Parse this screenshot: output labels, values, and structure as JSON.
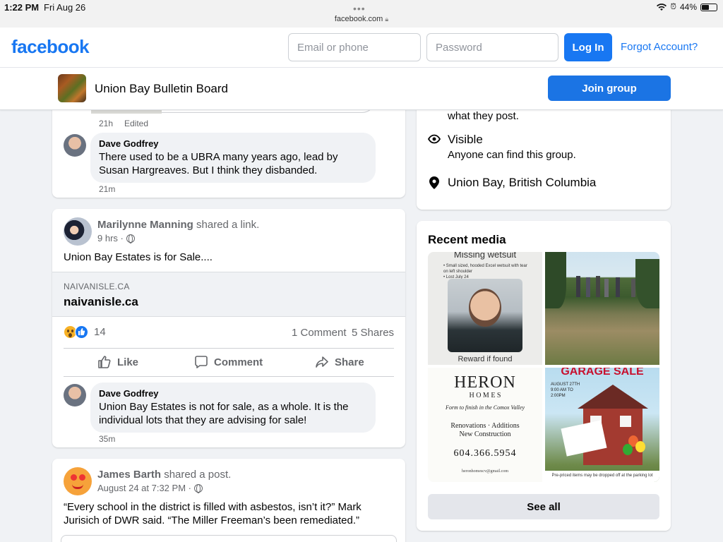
{
  "status_bar": {
    "time": "1:22 PM",
    "date": "Fri Aug 26",
    "url": "facebook.com",
    "battery": "44%",
    "battery_level": 0.44
  },
  "header": {
    "logo": "facebook",
    "email_placeholder": "Email or phone",
    "password_placeholder": "Password",
    "login_label": "Log In",
    "forgot_label": "Forgot Account?",
    "brand_color": "#1877f2"
  },
  "group": {
    "name": "Union Bay Bulletin Board",
    "join_label": "Join group"
  },
  "feed": {
    "card1": {
      "reply_time": "21h",
      "reply_edited": "Edited",
      "comment": {
        "author": "Dave Godfrey",
        "text": "There used to be a UBRA many years ago, lead by Susan Hargreaves. But I think they disbanded.",
        "time": "21m"
      }
    },
    "card2": {
      "author": "Marilynne Manning",
      "action": "shared a link.",
      "time": "9 hrs ·",
      "text": "Union Bay Estates is for Sale....",
      "link_domain": "NAIVANISLE.CA",
      "link_title": "naivanisle.ca",
      "reaction_count": "14",
      "comments_count": "1 Comment",
      "shares_count": "5 Shares",
      "actions": {
        "like": "Like",
        "comment": "Comment",
        "share": "Share"
      },
      "comment": {
        "author": "Dave Godfrey",
        "text": "Union Bay Estates is not for sale, as a whole. It is the individual lots that they are advising for sale!",
        "time": "35m"
      }
    },
    "card3": {
      "author": "James Barth",
      "action": "shared a post.",
      "time": "August 24 at 7:32 PM ·",
      "text": "“Every school in the district is filled with asbestos, isn’t it?” Mark Jurisich of DWR said. “The Miller Freeman’s been remediated.”"
    }
  },
  "about": {
    "privacy_tail": "what they post.",
    "visible_title": "Visible",
    "visible_sub": "Anyone can find this group.",
    "location": "Union Bay, British Columbia"
  },
  "recent_media": {
    "title": "Recent media",
    "see_all": "See all",
    "tile1": {
      "heading": "Missing wetsuit",
      "bullets": [
        "• Small sized, hooded Excel wetsuit with tear on left shoulder",
        "• Lost July 24"
      ],
      "footer": "Reward if found"
    },
    "tile3": {
      "brand": "HERON",
      "brand_sub": "H O M E S",
      "tagline": "Form to finish in the Comox Valley",
      "services_line1": "Renovations · Additions",
      "services_line2": "New Construction",
      "phone": "604.366.5954",
      "email": "heronhomescv@gmail.com"
    },
    "tile4": {
      "heading": "GARAGE SALE",
      "date_line1": "AUGUST 27TH",
      "date_line2": "9:00 AM TO",
      "date_line3": "2:00PM",
      "footer": "Pre-priced items may be dropped off at the parking lot"
    }
  }
}
